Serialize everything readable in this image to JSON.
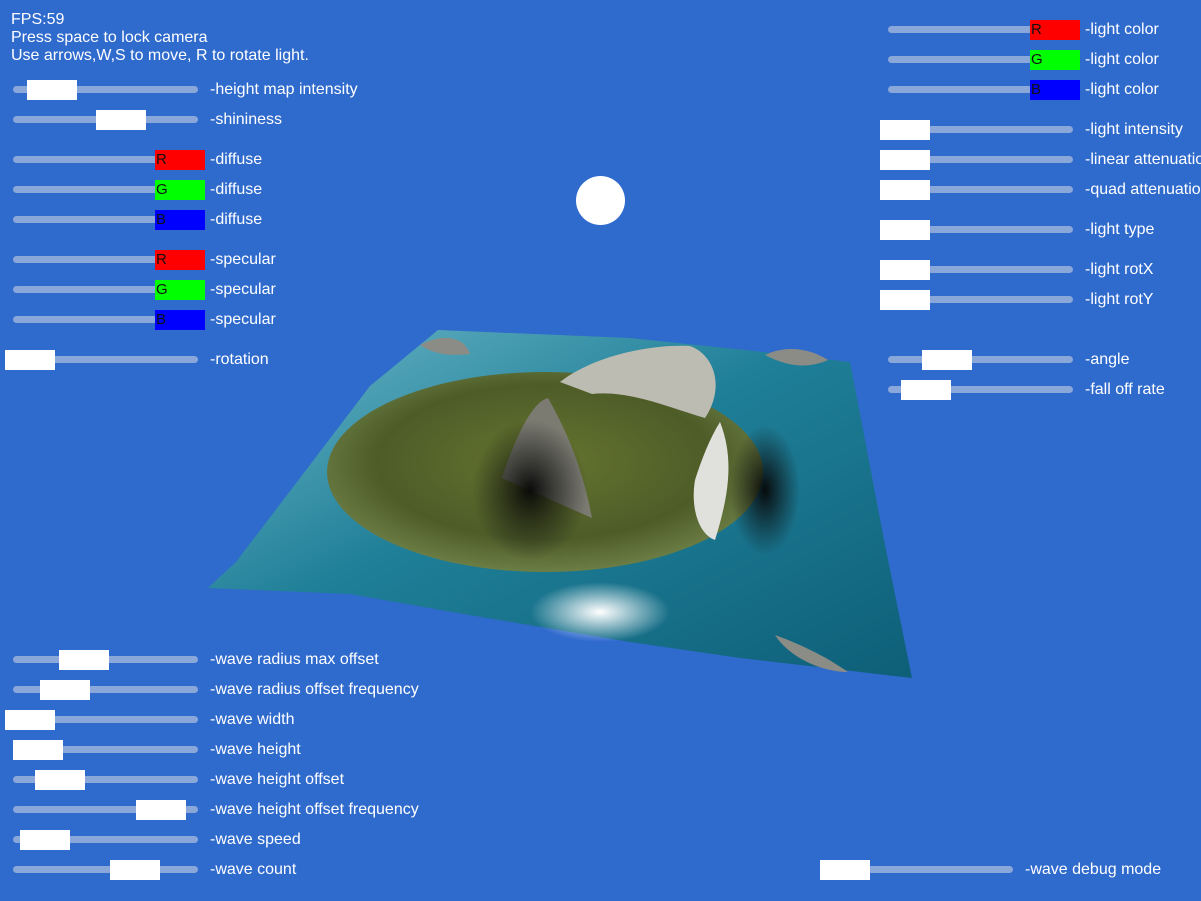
{
  "hud": {
    "fps": "FPS:59",
    "instruction_camera": "Press space to lock camera",
    "instruction_controls": "Use arrows,W,S to move, R to rotate light."
  },
  "colors": {
    "background": "#2f6acd",
    "track": "#8aa7d9",
    "thumb": "#ffffff",
    "red": "#ff0000",
    "green": "#00ff00",
    "blue": "#0000ff",
    "light_source": "#ffffff"
  },
  "scene": {
    "light_source_icon": "light-source-sphere",
    "terrain_icon": "heightmap-island-terrain"
  },
  "left_sliders": [
    {
      "name": "height-map-intensity",
      "label": "-height map intensity",
      "thumb_text": "",
      "thumb_color": "#ffffff",
      "value": 0.08
    },
    {
      "name": "shininess",
      "label": "-shininess",
      "thumb_text": "",
      "thumb_color": "#ffffff",
      "value": 0.45
    },
    {
      "name": "diffuse-r",
      "label": "-diffuse",
      "thumb_text": "R",
      "thumb_color": "#ff0000",
      "value": 1.0
    },
    {
      "name": "diffuse-g",
      "label": "-diffuse",
      "thumb_text": "G",
      "thumb_color": "#00ff00",
      "value": 1.0
    },
    {
      "name": "diffuse-b",
      "label": "-diffuse",
      "thumb_text": "B",
      "thumb_color": "#0000ff",
      "value": 1.0
    },
    {
      "name": "specular-r",
      "label": "-specular",
      "thumb_text": "R",
      "thumb_color": "#ff0000",
      "value": 1.0
    },
    {
      "name": "specular-g",
      "label": "-specular",
      "thumb_text": "G",
      "thumb_color": "#00ff00",
      "value": 1.0
    },
    {
      "name": "specular-b",
      "label": "-specular",
      "thumb_text": "B",
      "thumb_color": "#0000ff",
      "value": 1.0
    },
    {
      "name": "rotation",
      "label": "-rotation",
      "thumb_text": "",
      "thumb_color": "#ffffff",
      "value": 0.0
    }
  ],
  "wave_sliders": [
    {
      "name": "wave-radius-max-offset",
      "label": "-wave radius max offset",
      "thumb_text": "",
      "thumb_color": "#ffffff",
      "value": 0.25
    },
    {
      "name": "wave-radius-offset-frequency",
      "label": "-wave radius offset frequency",
      "thumb_text": "",
      "thumb_color": "#ffffff",
      "value": 0.15
    },
    {
      "name": "wave-width",
      "label": "-wave width",
      "thumb_text": "",
      "thumb_color": "#ffffff",
      "value": 0.0
    },
    {
      "name": "wave-height",
      "label": "-wave height",
      "thumb_text": "",
      "thumb_color": "#ffffff",
      "value": 0.05
    },
    {
      "name": "wave-height-offset",
      "label": "-wave height offset",
      "thumb_text": "",
      "thumb_color": "#ffffff",
      "value": 0.17
    },
    {
      "name": "wave-height-offset-frequency",
      "label": "-wave height offset frequency",
      "thumb_text": "",
      "thumb_color": "#ffffff",
      "value": 0.73
    },
    {
      "name": "wave-speed",
      "label": "-wave speed",
      "thumb_text": "",
      "thumb_color": "#ffffff",
      "value": 0.08
    },
    {
      "name": "wave-count",
      "label": "-wave count",
      "thumb_text": "",
      "thumb_color": "#ffffff",
      "value": 0.55
    }
  ],
  "right_sliders": [
    {
      "name": "light-color-r",
      "label": "-light color",
      "thumb_text": "R",
      "thumb_color": "#ff0000",
      "value": 1.0
    },
    {
      "name": "light-color-g",
      "label": "-light color",
      "thumb_text": "G",
      "thumb_color": "#00ff00",
      "value": 1.0
    },
    {
      "name": "light-color-b",
      "label": "-light color",
      "thumb_text": "B",
      "thumb_color": "#0000ff",
      "value": 1.0
    },
    {
      "name": "light-intensity",
      "label": "-light intensity",
      "thumb_text": "",
      "thumb_color": "#ffffff",
      "value": 0.0
    },
    {
      "name": "linear-attenuation",
      "label": "-linear attenuatio",
      "thumb_text": "",
      "thumb_color": "#ffffff",
      "value": 0.0
    },
    {
      "name": "quad-attenuation",
      "label": "-quad attenuatio",
      "thumb_text": "",
      "thumb_color": "#ffffff",
      "value": 0.0
    },
    {
      "name": "light-type",
      "label": "-light type",
      "thumb_text": "",
      "thumb_color": "#ffffff",
      "value": 0.0
    },
    {
      "name": "light-rot-x",
      "label": "-light rotX",
      "thumb_text": "",
      "thumb_color": "#ffffff",
      "value": 0.0
    },
    {
      "name": "light-rot-y",
      "label": "-light rotY",
      "thumb_text": "",
      "thumb_color": "#ffffff",
      "value": 0.0
    },
    {
      "name": "angle",
      "label": "-angle",
      "thumb_text": "",
      "thumb_color": "#ffffff",
      "value": 0.25
    },
    {
      "name": "fall-off-rate",
      "label": "-fall off rate",
      "thumb_text": "",
      "thumb_color": "#ffffff",
      "value": 0.1
    }
  ],
  "debug_slider": {
    "name": "wave-debug-mode",
    "label": "-wave debug mode",
    "thumb_text": "",
    "thumb_color": "#ffffff",
    "value": 0.0
  }
}
